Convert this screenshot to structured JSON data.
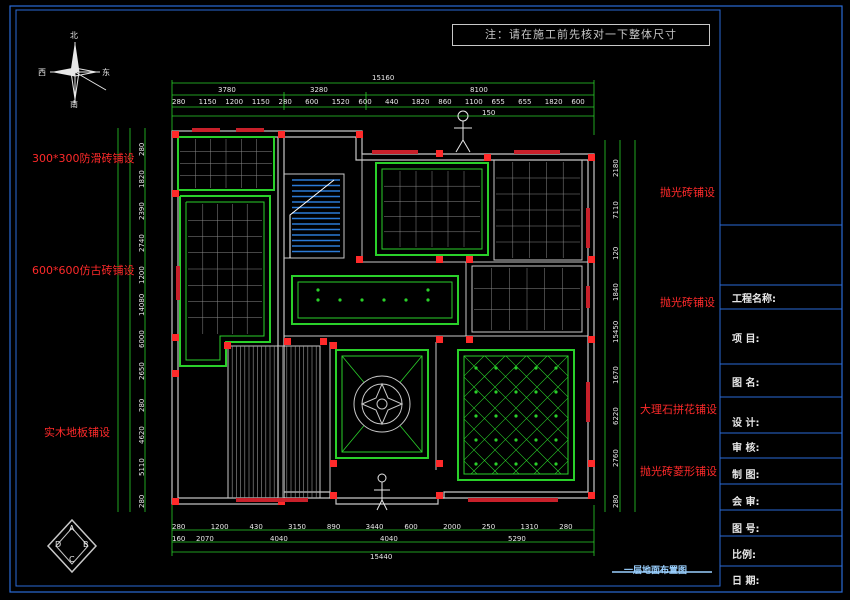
{
  "note": "注：请在施工前先核对一下整体尺寸",
  "compass": {
    "north": "北",
    "south": "南",
    "east": "东",
    "west": "西"
  },
  "title_block": {
    "project_name": "工程名称:",
    "item": "项  目:",
    "drawing_name": "图  名:",
    "design": "设  计:",
    "review": "审  核:",
    "draw": "制  图:",
    "approve": "会  审:",
    "drawing_no": "图  号:",
    "scale": "比例:",
    "date": "日  期:"
  },
  "sheet_title": "一层地面布置图",
  "annotations": {
    "anti_slip": "300*300防滑砖铺设",
    "antique": "600*600仿古砖铺设",
    "wood": "实木地板铺设",
    "polished1": "抛光砖铺设",
    "polished2": "抛光砖铺设",
    "marble": "大理石拼花铺设",
    "polished_diamond": "抛光砖菱形铺设"
  },
  "dims_top": {
    "overall": "15160",
    "seg1": "3780",
    "seg2": "3280",
    "seg3": "8100",
    "row": [
      "280",
      "1150",
      "1200",
      "1150",
      "280",
      "600",
      "1520",
      "600",
      "440",
      "1820",
      "860",
      "1100",
      "655",
      "655",
      "1820",
      "600"
    ],
    "small": "150"
  },
  "dims_bottom": {
    "row": [
      "280",
      "1200",
      "430",
      "3150",
      "890",
      "3440",
      "600",
      "2000",
      "250",
      "1310",
      "280"
    ],
    "row2": [
      "160",
      "2070",
      "4040",
      "4040",
      "5290"
    ],
    "overall": "15440"
  },
  "dims_left": [
    "280",
    "1820",
    "2390",
    "2740",
    "1200",
    "14080",
    "6000",
    "2650",
    "280",
    "4620",
    "5110",
    "280"
  ],
  "dims_right": [
    "2180",
    "7110",
    "120",
    "1840",
    "15450",
    "1670",
    "6220",
    "2760",
    "280"
  ],
  "logo": {
    "a": "A",
    "b": "B",
    "c": "C",
    "d": "D"
  }
}
